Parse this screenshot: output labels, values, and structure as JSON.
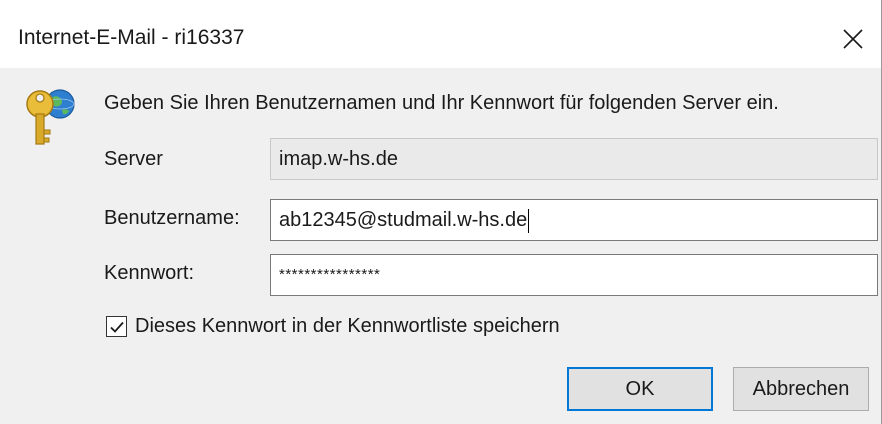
{
  "window": {
    "title": "Internet-E-Mail - ri16337"
  },
  "message": "Geben Sie Ihren Benutzernamen und Ihr Kennwort für folgenden Server ein.",
  "form": {
    "server_label": "Server",
    "server_value": "imap.w-hs.de",
    "username_label": "Benutzername:",
    "username_value": "ab12345@studmail.w-hs.de",
    "password_label": "Kennwort:",
    "password_value": "****************",
    "remember_label": "Dieses Kennwort in der Kennwortliste speichern",
    "remember_checked": true
  },
  "buttons": {
    "ok_label": "OK",
    "cancel_label": "Abbrechen"
  },
  "colors": {
    "accent": "#0078d7",
    "dialog_bg": "#f0f0f0",
    "key_gold": "#d9a92a",
    "globe_blue": "#2f7fd0"
  },
  "icons": {
    "dialog_icon": "key-globe-icon",
    "close": "close-icon",
    "check": "checkmark-icon"
  }
}
